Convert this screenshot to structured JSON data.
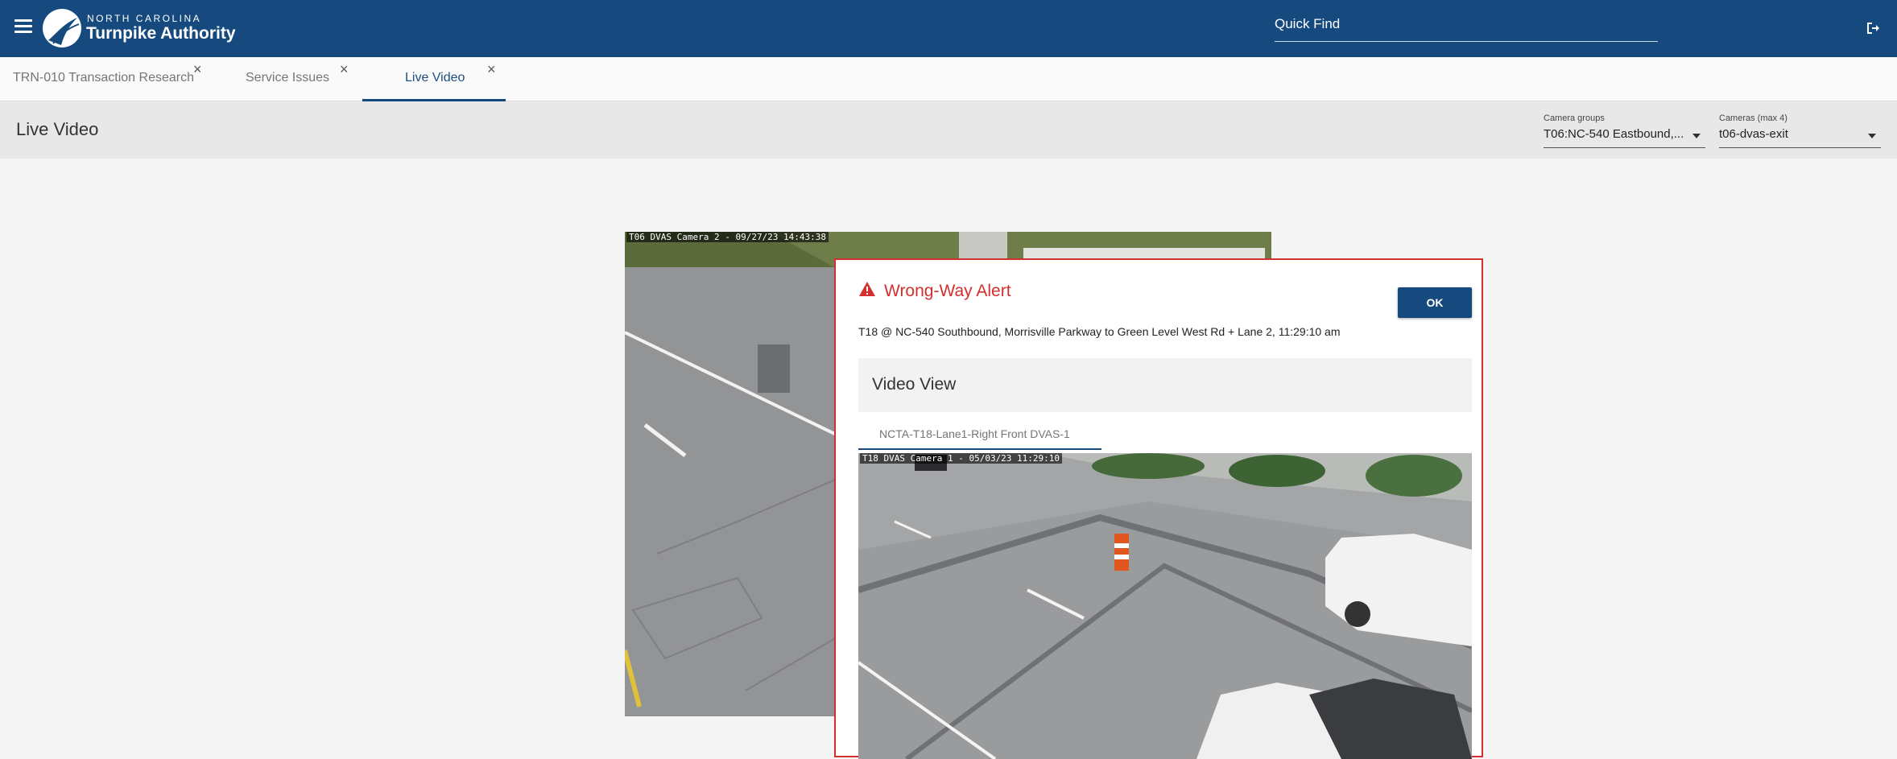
{
  "header": {
    "logo_small": "NORTH CAROLINA",
    "logo_big": "Turnpike Authority",
    "quick_find_placeholder": "Quick Find",
    "menu_icon": "hamburger-menu-icon",
    "logout_icon": "logout-icon",
    "colors": {
      "bar": "#164a7e",
      "text": "#ffffff"
    }
  },
  "tabs": [
    {
      "label": "TRN-010 Transaction Research",
      "active": false
    },
    {
      "label": "Service Issues",
      "active": false
    },
    {
      "label": "Live Video",
      "active": true
    }
  ],
  "tab_close_glyph": "×",
  "page": {
    "title": "Live Video",
    "camera_groups": {
      "label": "Camera groups",
      "value": "T06:NC-540 Eastbound,..."
    },
    "cameras": {
      "label": "Cameras (max 4)",
      "value": "t06-dvas-exit"
    }
  },
  "main_video": {
    "caption": "T06 DVAS Camera 2 - 09/27/23 14:43:38"
  },
  "alert": {
    "title": "Wrong-Way Alert",
    "icon": "warning-triangle-icon",
    "ok_label": "OK",
    "message": "T18 @ NC-540 Southbound, Morrisville Parkway to Green Level West Rd + Lane 2, 11:29:10 am",
    "video_view_title": "Video View",
    "camera_tab": "NCTA-T18-Lane1-Right Front DVAS-1",
    "video_caption": "T18 DVAS Camera 1 - 05/03/23 11:29:10",
    "colors": {
      "border": "#d32f2f",
      "title": "#d32f2f",
      "button": "#164a7e"
    }
  }
}
